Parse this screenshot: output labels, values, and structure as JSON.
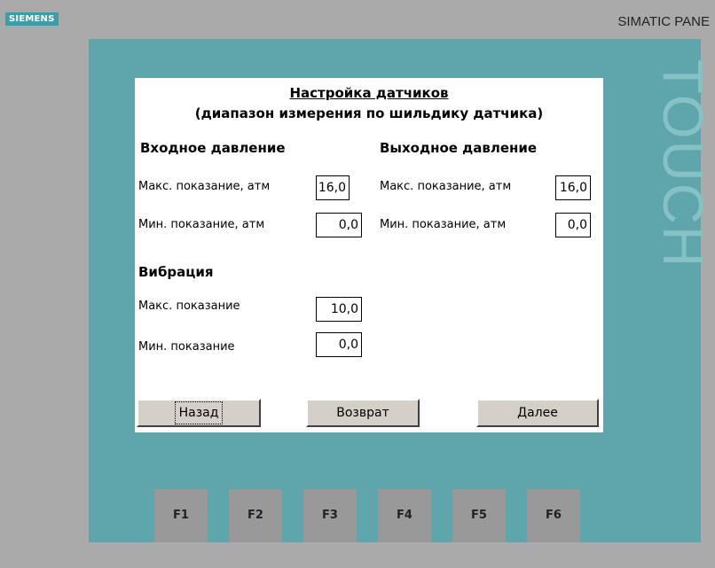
{
  "device": {
    "brand": "SIEMENS",
    "model": "SIMATIC PANE",
    "touch_label": "TOUCH"
  },
  "screen": {
    "title": "Настройка датчиков",
    "subtitle": "(диапазон измерения по шильдику датчика)",
    "inlet": {
      "heading": "Входное давление",
      "max_label": "Макс. показание, атм",
      "max_value": "16,0",
      "min_label": "Мин. показание, атм",
      "min_value": "0,0"
    },
    "outlet": {
      "heading": "Выходное давление",
      "max_label": "Макс. показание, атм",
      "max_value": "16,0",
      "min_label": "Мин. показание, атм",
      "min_value": "0,0"
    },
    "vibration": {
      "heading": "Вибрация",
      "max_label": "Макс. показание",
      "max_value": "10,0",
      "min_label": "Мин. показание",
      "min_value": "0,0"
    },
    "buttons": {
      "back": "Назад",
      "return": "Возврат",
      "next": "Далее"
    }
  },
  "function_keys": [
    "F1",
    "F2",
    "F3",
    "F4",
    "F5",
    "F6"
  ],
  "colors": {
    "bezel": "#aaaaaa",
    "frame": "#5fa6ac",
    "brand_badge": "#3f9da6",
    "button_face": "#d4d0c8"
  }
}
